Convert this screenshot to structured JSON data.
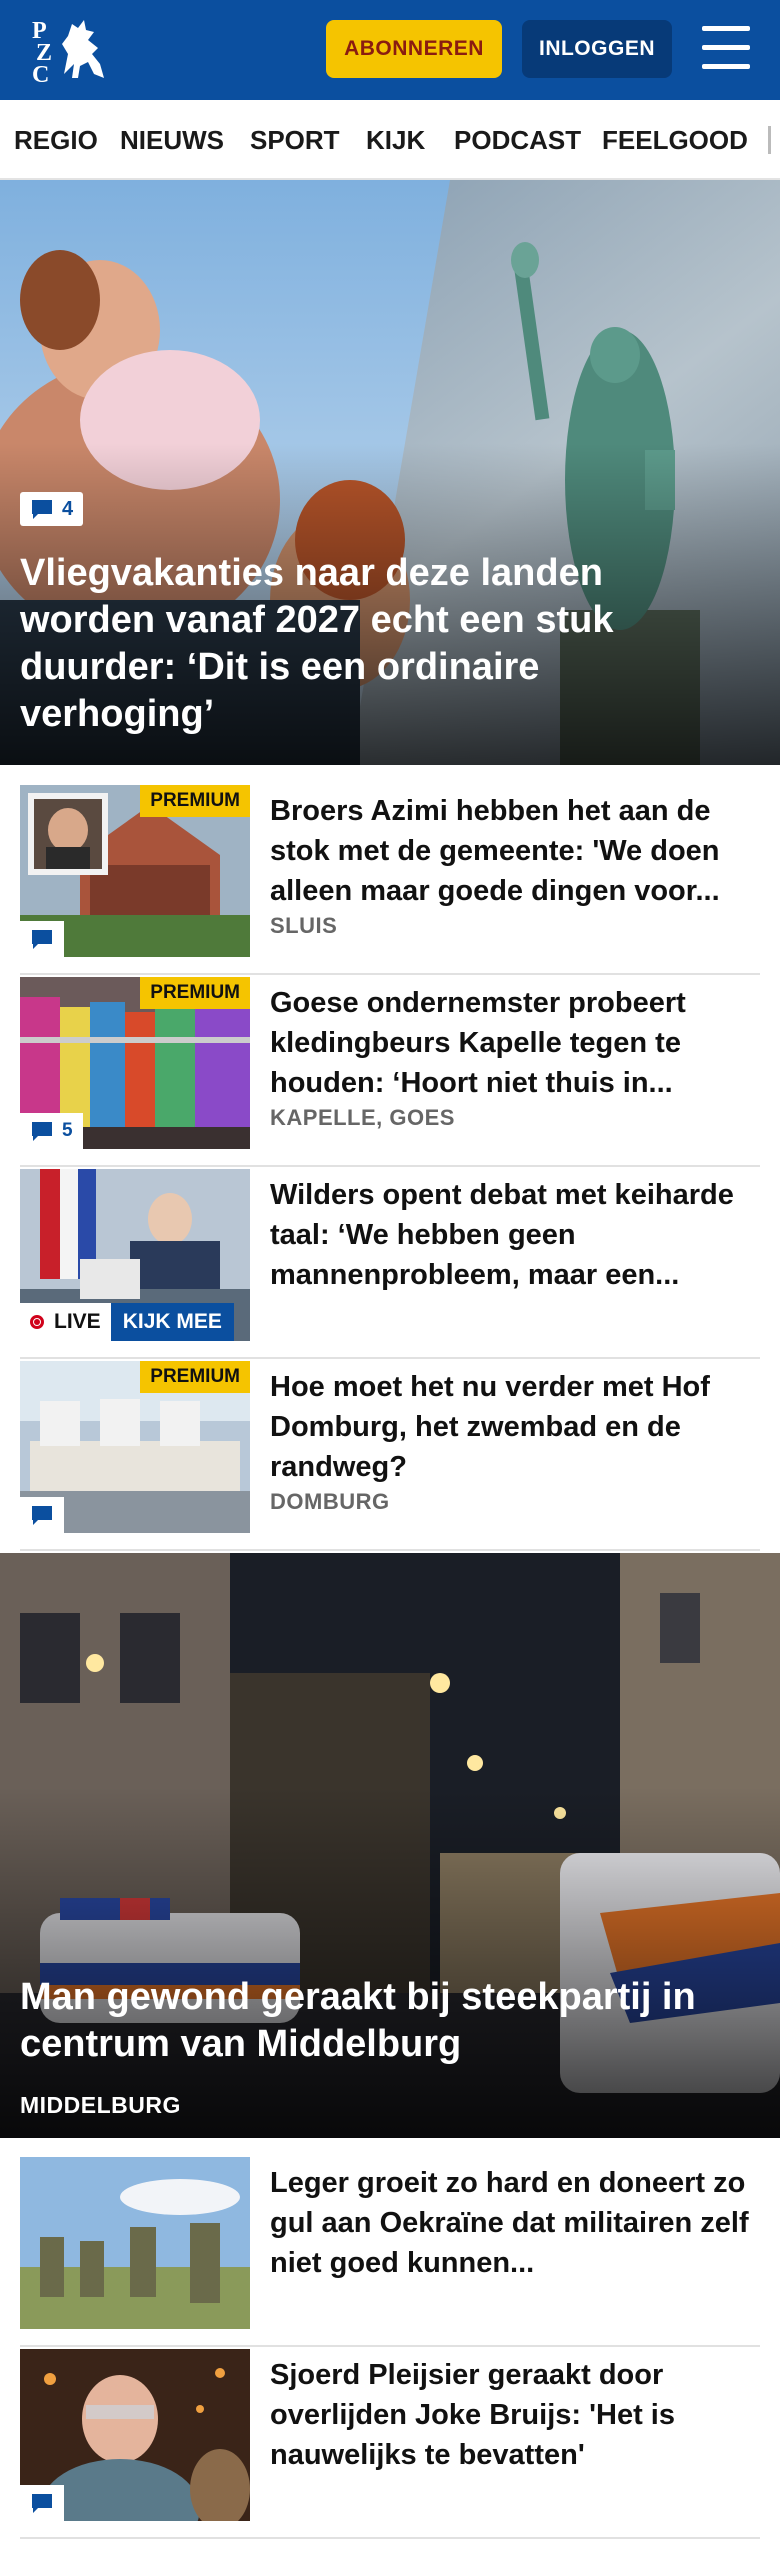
{
  "header": {
    "logo_text": "PZC",
    "subscribe_label": "ABONNEREN",
    "login_label": "INLOGGEN",
    "brand_color": "#0b4f9f",
    "accent_color": "#f5c400"
  },
  "nav": {
    "items": [
      {
        "label": "REGIO"
      },
      {
        "label": "NIEUWS"
      },
      {
        "label": "SPORT"
      },
      {
        "label": "KIJK"
      },
      {
        "label": "PODCAST"
      },
      {
        "label": "FEELGOOD"
      }
    ]
  },
  "hero": {
    "comment_count": "4",
    "title": "Vliegvakanties naar deze landen worden vanaf 2027 echt een stuk duurder: ‘Dit is een ordinaire verhoging’"
  },
  "articles": [
    {
      "badge": "PREMIUM",
      "title": "Broers Azimi hebben het aan de stok met de gemeente: 'We doen alleen maar goede dingen voor...",
      "location": "SLUIS",
      "comment_count": ""
    },
    {
      "badge": "PREMIUM",
      "title": "Goese ondernemster probeert kledingbeurs Kapelle tegen te houden: ‘Hoort niet thuis in...",
      "location": "KAPELLE, GOES",
      "comment_count": "5"
    },
    {
      "live_label": "LIVE",
      "watch_label": "KIJK MEE",
      "title": "Wilders opent debat met keiharde taal: ‘We hebben geen mannenprobleem, maar een..."
    },
    {
      "badge": "PREMIUM",
      "title": "Hoe moet het nu verder met Hof Domburg, het zwembad en de randweg?",
      "location": "DOMBURG",
      "comment_count": ""
    }
  ],
  "big_story": {
    "title": "Man gewond geraakt bij steekpartij in centrum van Middelburg",
    "location": "MIDDELBURG"
  },
  "more_articles": [
    {
      "title": "Leger groeit zo hard en doneert zo gul aan Oekraïne dat militairen zelf niet goed kunnen..."
    },
    {
      "title": "Sjoerd Pleijsier geraakt door overlijden Joke Bruijs: 'Het is nauwelijks te bevatten'",
      "comment_count": ""
    }
  ]
}
